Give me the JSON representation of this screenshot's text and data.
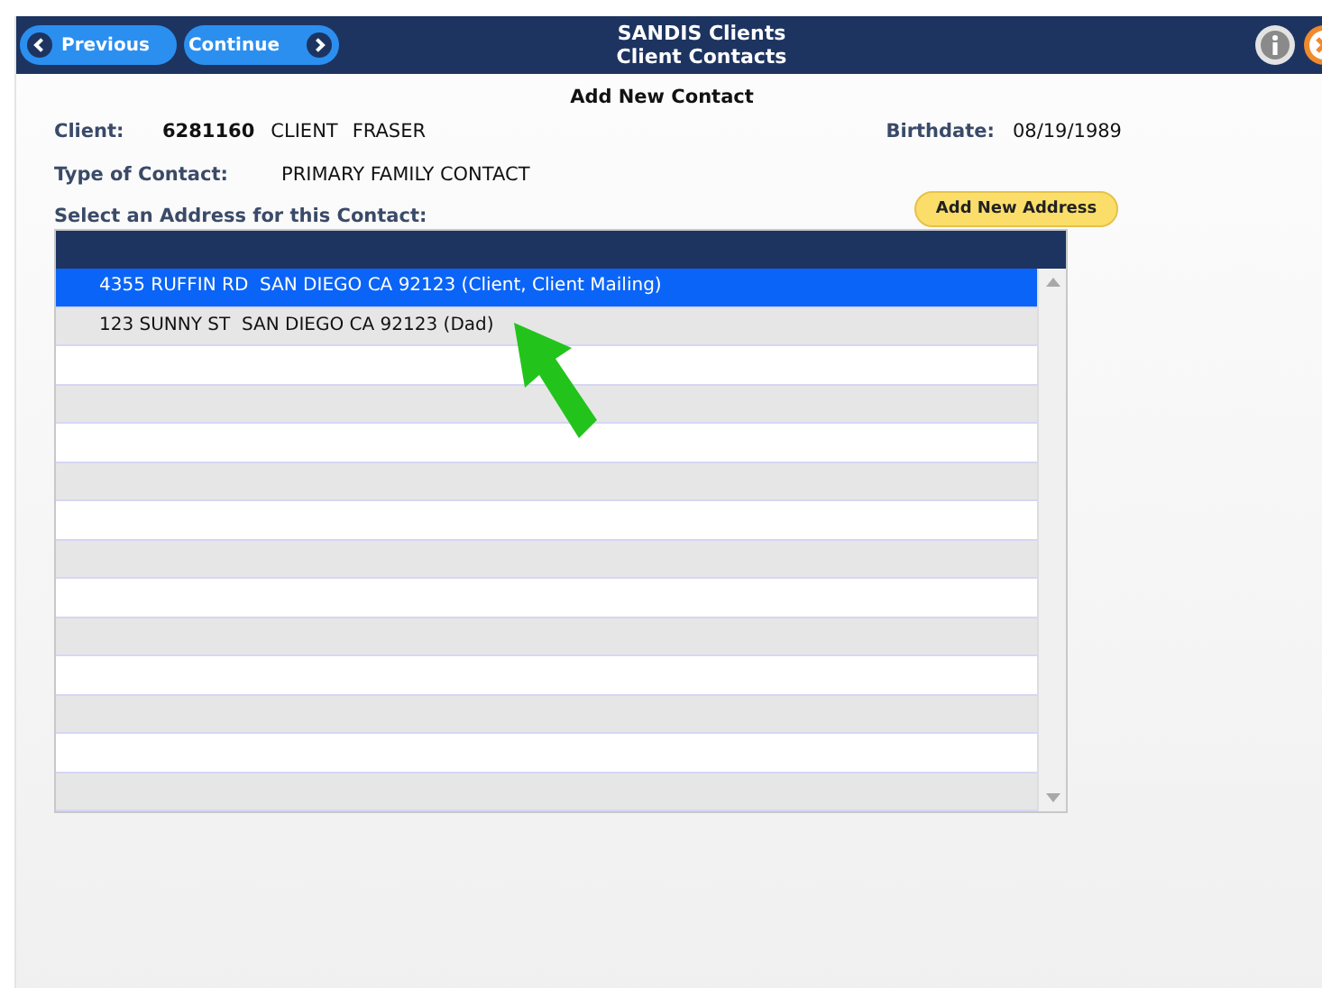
{
  "toolbar": {
    "buttons": [
      {
        "label": "Previous",
        "kind": "back"
      },
      {
        "label": "Continue",
        "kind": "forward"
      }
    ],
    "title": "SANDIS Clients",
    "subtitle": "Client Contacts"
  },
  "form": {
    "heading": "Add New Contact",
    "client_label": "Client:",
    "client_number": "6281160",
    "client_first": "CLIENT",
    "client_last": "FRASER",
    "birthdate_label": "Birthdate:",
    "birthdate": "08/19/1989",
    "type_label": "Type of Contact:",
    "type_value": "PRIMARY FAMILY CONTACT",
    "address_label": "Select an Address for this Contact:",
    "add_button": "Add New Address"
  },
  "addresses": [
    {
      "text": "4355 RUFFIN RD  SAN DIEGO CA 92123 (Client, Client Mailing)",
      "selected": true
    },
    {
      "text": "123 SUNNY ST  SAN DIEGO CA 92123 (Dad)",
      "selected": false
    }
  ]
}
